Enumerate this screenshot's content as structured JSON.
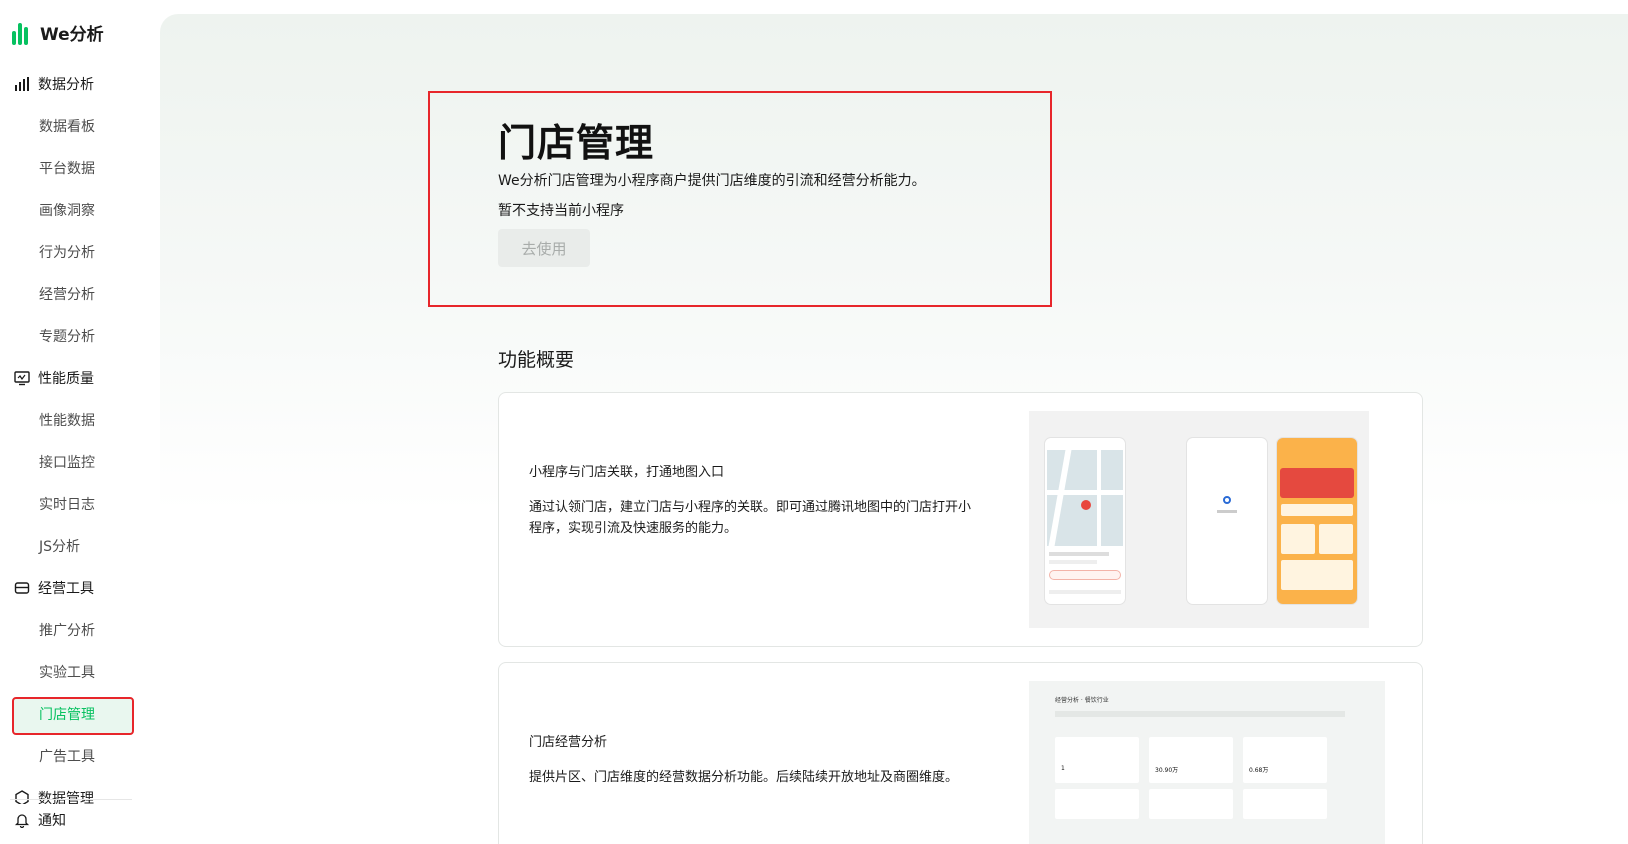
{
  "app": {
    "name": "We分析"
  },
  "sidebar": {
    "groups": [
      {
        "label": "数据分析",
        "icon": "bar-chart-icon",
        "items": [
          "数据看板",
          "平台数据",
          "画像洞察",
          "行为分析",
          "经营分析",
          "专题分析"
        ]
      },
      {
        "label": "性能质量",
        "icon": "monitor-icon",
        "items": [
          "性能数据",
          "接口监控",
          "实时日志",
          "JS分析"
        ]
      },
      {
        "label": "经营工具",
        "icon": "wallet-icon",
        "items": [
          "推广分析",
          "实验工具",
          "门店管理",
          "广告工具"
        ]
      },
      {
        "label": "数据管理",
        "icon": "hexagon-icon",
        "items": []
      }
    ],
    "active_item": "门店管理",
    "notify_label": "通知"
  },
  "hero": {
    "title": "门店管理",
    "description": "We分析门店管理为小程序商户提供门店维度的引流和经营分析能力。",
    "note": "暂不支持当前小程序",
    "button_label": "去使用"
  },
  "overview": {
    "title": "功能概要",
    "cards": [
      {
        "title": "小程序与门店关联，打通地图入口",
        "text": "通过认领门店，建立门店与小程序的关联。即可通过腾讯地图中的门店打开小程序，实现引流及快速服务的能力。"
      },
      {
        "title": "门店经营分析",
        "text": "提供片区、门店维度的经营数据分析功能。后续陆续开放地址及商圈维度。"
      }
    ],
    "preview2": {
      "header": "经营分析 · 餐饮行业",
      "values": [
        "1",
        "30.90万",
        "0.68万"
      ]
    }
  },
  "colors": {
    "accent": "#07c160",
    "highlight_border": "#e7262b"
  }
}
